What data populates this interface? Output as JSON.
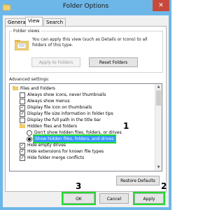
{
  "window": {
    "title": "Folder Options",
    "close_glyph": "✕"
  },
  "tabs": [
    {
      "label": "General",
      "active": false
    },
    {
      "label": "View",
      "active": true
    },
    {
      "label": "Search",
      "active": false
    }
  ],
  "folder_views": {
    "legend": "Folder views",
    "description": "You can apply this view (such as Details or Icons) to all folders of this type.",
    "apply_button": "Apply to Folders",
    "reset_button": "Reset Folders"
  },
  "advanced": {
    "label": "Advanced settings:",
    "items": [
      {
        "kind": "folder",
        "label": "Files and Folders"
      },
      {
        "kind": "checkbox",
        "checked": false,
        "label": "Always show icons, never thumbnails"
      },
      {
        "kind": "checkbox",
        "checked": false,
        "label": "Always show menus"
      },
      {
        "kind": "checkbox",
        "checked": true,
        "label": "Display file icon on thumbnails"
      },
      {
        "kind": "checkbox",
        "checked": true,
        "label": "Display file size information in folder tips"
      },
      {
        "kind": "checkbox",
        "checked": false,
        "label": "Display the full path in the title bar"
      },
      {
        "kind": "folder",
        "label": "Hidden files and folders"
      },
      {
        "kind": "radio",
        "selected": false,
        "label": "Don't show hidden files, folders, or drives"
      },
      {
        "kind": "radio",
        "selected": true,
        "label": "Show hidden files, folders, and drives"
      },
      {
        "kind": "checkbox",
        "checked": true,
        "label": "Hide empty drives"
      },
      {
        "kind": "checkbox",
        "checked": true,
        "label": "Hide extensions for known file types"
      },
      {
        "kind": "checkbox",
        "checked": true,
        "label": "Hide folder merge conflicts"
      }
    ],
    "scroll_up": "▲",
    "scroll_down": "▼"
  },
  "restore_defaults_button": "Restore Defaults",
  "footer": {
    "ok": "OK",
    "cancel": "Cancel",
    "apply": "Apply"
  },
  "annotations": {
    "step1": "1",
    "step2": "2",
    "step3": "3",
    "color": "#1edc2c"
  },
  "checkmark": "✓"
}
